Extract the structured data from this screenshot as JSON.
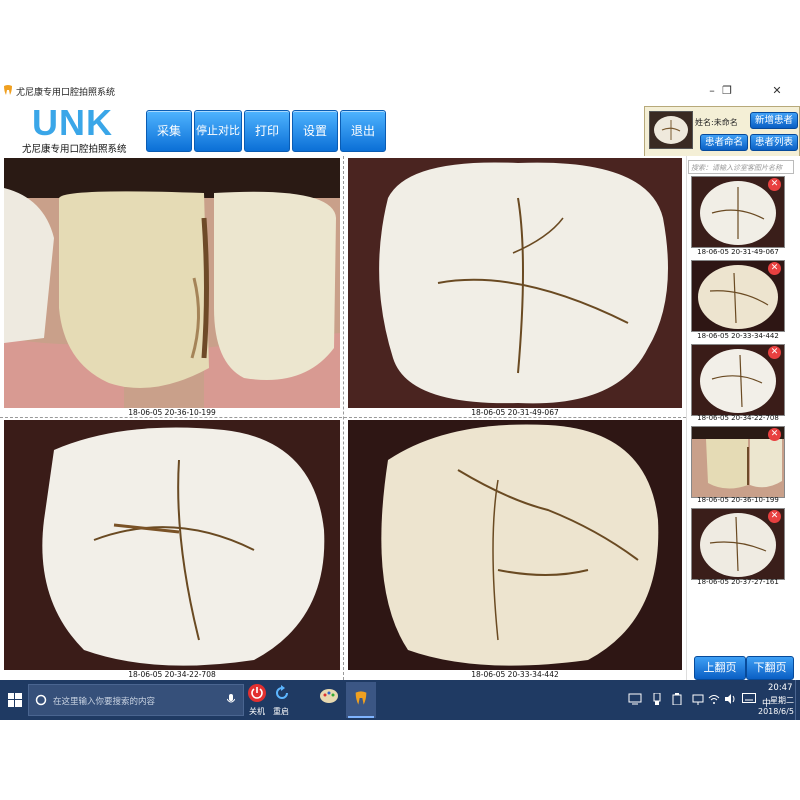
{
  "window": {
    "title": "尤尼康专用口腔拍照系统"
  },
  "logo": {
    "mark": "UNK",
    "subtitle": "尤尼康专用口腔拍照系统"
  },
  "toolbar": {
    "buttons": [
      "采集",
      "停止对比",
      "打印",
      "设置",
      "退出"
    ]
  },
  "patient": {
    "name_label": "姓名:未命名",
    "new_patient": "新增患者",
    "rename_patient": "患者命名",
    "patient_list": "患者列表"
  },
  "grid": {
    "captions": [
      "18-06-05 20-36-10-199",
      "18-06-05 20-31-49-067",
      "18-06-05 20-34-22-708",
      "18-06-05 20-33-34-442"
    ]
  },
  "sidebar": {
    "search_placeholder": "搜索：请输入诊室客图片名称",
    "thumbnails": [
      "18-06-05 20-31-49-067",
      "18-06-05 20-33-34-442",
      "18-06-05 20-34-22-708",
      "18-06-05 20-36-10-199",
      "18-06-05 20-37-27-161"
    ],
    "prev_page": "上翻页",
    "next_page": "下翻页"
  },
  "taskbar": {
    "search_placeholder": "在这里输入你要搜索的内容",
    "shutdown_label": "关机",
    "restart_label": "重启",
    "ime": "中",
    "time": "20:47",
    "weekday": "星期二",
    "date": "2018/6/5"
  },
  "colors": {
    "accent": "#0b6fd6",
    "taskbar": "#1f3a63",
    "logo": "#3aa6e8",
    "delete": "#e84040"
  }
}
